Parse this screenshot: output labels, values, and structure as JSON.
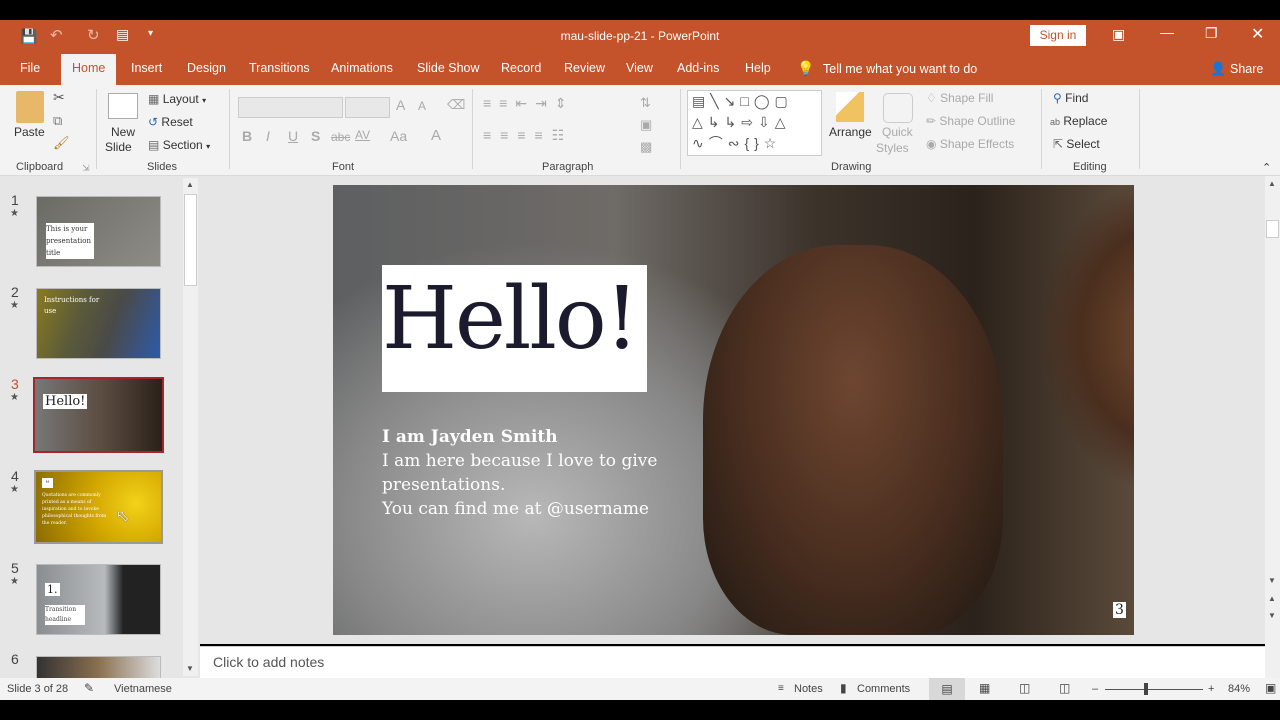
{
  "window": {
    "title": "mau-slide-pp-21  -  PowerPoint",
    "sign_in": "Sign in"
  },
  "tabs": [
    "File",
    "Home",
    "Insert",
    "Design",
    "Transitions",
    "Animations",
    "Slide Show",
    "Record",
    "Review",
    "View",
    "Add-ins",
    "Help"
  ],
  "tell_me": "Tell me what you want to do",
  "share": "Share",
  "ribbon": {
    "clipboard": {
      "paste": "Paste",
      "label": "Clipboard"
    },
    "slides": {
      "new_slide_1": "New",
      "new_slide_2": "Slide",
      "layout": "Layout",
      "reset": "Reset",
      "section": "Section",
      "label": "Slides"
    },
    "font": {
      "bold": "B",
      "italic": "I",
      "underline": "U",
      "shadow": "S",
      "strike": "abc",
      "spacing": "AV",
      "case": "Aa",
      "color": "A",
      "grow": "A",
      "shrink": "A",
      "label": "Font"
    },
    "paragraph": {
      "label": "Paragraph"
    },
    "drawing": {
      "arrange": "Arrange",
      "quick_styles_1": "Quick",
      "quick_styles_2": "Styles",
      "shape_fill": "Shape Fill",
      "shape_outline": "Shape Outline",
      "shape_effects": "Shape Effects",
      "label": "Drawing"
    },
    "editing": {
      "find": "Find",
      "replace": "Replace",
      "select": "Select",
      "label": "Editing"
    }
  },
  "thumbnails": [
    {
      "num": "1",
      "title": "This is your presentation title"
    },
    {
      "num": "2",
      "title": "Instructions for use"
    },
    {
      "num": "3",
      "title": "Hello!"
    },
    {
      "num": "4",
      "title": "Quotations are commonly printed as a means of inspiration and to invoke philosophical thoughts from the reader.",
      "quote": "“"
    },
    {
      "num": "5",
      "title": "1.",
      "subtitle": "Transition headline"
    },
    {
      "num": "6"
    }
  ],
  "slide": {
    "title": "Hello!",
    "name": "I am Jayden Smith",
    "line1": "I am here because I love to give",
    "line2": "presentations.",
    "line3": "You can find me at @username",
    "page": "3"
  },
  "notes_placeholder": "Click to add notes",
  "status": {
    "slide": "Slide 3 of 28",
    "language": "Vietnamese",
    "notes": "Notes",
    "comments": "Comments",
    "zoom": "84%"
  },
  "colors": {
    "accent": "#c4522b",
    "selected_thumb": "#a4262c"
  }
}
